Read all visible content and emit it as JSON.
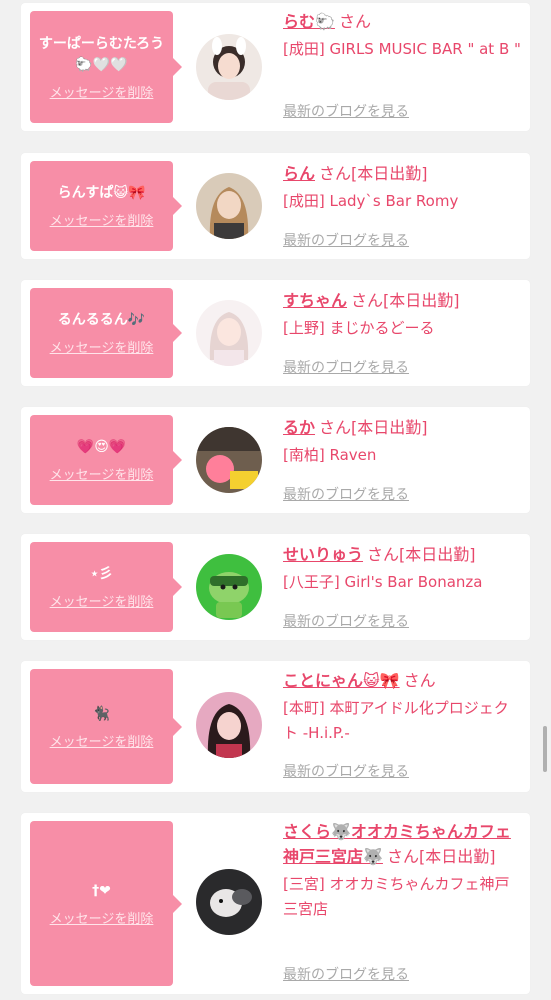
{
  "common": {
    "delete_label": "メッセージを削除",
    "san_suffix": "さん",
    "blog_label": "最新のブログを見る"
  },
  "colors": {
    "accent_pink": "#f78ea7",
    "text_pink": "#e8476b",
    "muted_gray": "#a9a9a9"
  },
  "items": [
    {
      "message": "すーぱーらむたろう🐑🤍🤍",
      "name": "らむ🐑",
      "status": "",
      "shop": "[成田] GIRLS MUSIC BAR \" at B \""
    },
    {
      "message": "らんすぱ😺🎀",
      "name": "らん",
      "status": "[本日出勤]",
      "shop": "[成田] Lady`s Bar Romy"
    },
    {
      "message": "るんるるん🎶",
      "name": "すちゃん",
      "status": "[本日出勤]",
      "shop": "[上野] まじかるどーる"
    },
    {
      "message": "💗😍💗",
      "name": "るか",
      "status": "[本日出勤]",
      "shop": "[南柏] Raven"
    },
    {
      "message": "⋆彡",
      "name": "せいりゅう",
      "status": "[本日出勤]",
      "shop": "[八王子] Girl's Bar Bonanza"
    },
    {
      "message": "🐈‍⬛",
      "name": "ことにゃん😺🎀",
      "status": "",
      "shop": "[本町] 本町アイドル化プロジェクト -H.i.P.-"
    },
    {
      "message": "†❤",
      "name": "さくら🐺オオカミちゃんカフェ神戸三宮店🐺",
      "status": "[本日出勤]",
      "shop": "[三宮] オオカミちゃんカフェ神戸三宮店"
    }
  ]
}
